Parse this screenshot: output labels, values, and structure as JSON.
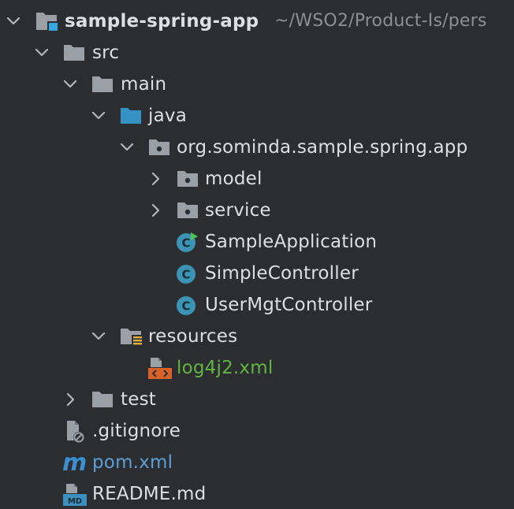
{
  "project": {
    "name": "sample-spring-app",
    "path": "~/WSO2/Product-Is/pers"
  },
  "tree": {
    "src": "src",
    "main": "main",
    "java": "java",
    "package": "org.sominda.sample.spring.app",
    "model": "model",
    "service": "service",
    "sample_application": "SampleApplication",
    "simple_controller": "SimpleController",
    "usermgt_controller": "UserMgtController",
    "resources": "resources",
    "log4j2": "log4j2.xml",
    "test": "test",
    "gitignore": ".gitignore",
    "pom": "pom.xml",
    "readme": "README.md"
  },
  "colors": {
    "background": "#2b2d30",
    "text": "#dcdfe4",
    "muted": "#8c8f94",
    "folder": "#9aa0a6",
    "source_folder": "#3592c4",
    "class_icon": "#3b93b6",
    "run_marker": "#4fc35a",
    "modified_file": "#62b543",
    "pom_file": "#5c9fd6",
    "xml_icon": "#d9622b",
    "resources_marker": "#e3b341"
  },
  "icons": {
    "project": "module-folder-icon",
    "folder": "folder-icon",
    "source_folder": "source-folder-icon",
    "package": "package-icon",
    "resources": "resources-folder-icon",
    "class": "java-class-icon",
    "xml": "xml-file-icon",
    "ignore": "ignore-file-icon",
    "maven": "maven-icon",
    "markdown": "markdown-file-icon"
  }
}
